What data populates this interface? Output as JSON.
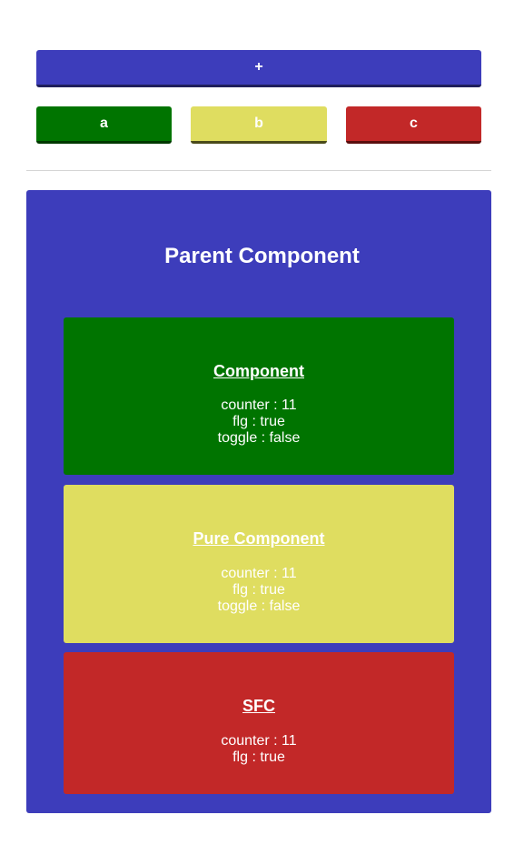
{
  "controls": {
    "plus_label": "+",
    "a_label": "a",
    "b_label": "b",
    "c_label": "c"
  },
  "parent": {
    "title": "Parent Component"
  },
  "cards": {
    "component": {
      "title": "Component",
      "counter": "counter : 11",
      "flg": "flg : true",
      "toggle": "toggle : false"
    },
    "pure": {
      "title": "Pure Component",
      "counter": "counter : 11",
      "flg": "flg : true",
      "toggle": "toggle : false"
    },
    "sfc": {
      "title": "SFC",
      "counter": "counter : 11",
      "flg": "flg : true"
    }
  },
  "colors": {
    "blue": "#3d3dbb",
    "green": "#007400",
    "yellow": "#dfdd60",
    "red": "#c22828"
  }
}
